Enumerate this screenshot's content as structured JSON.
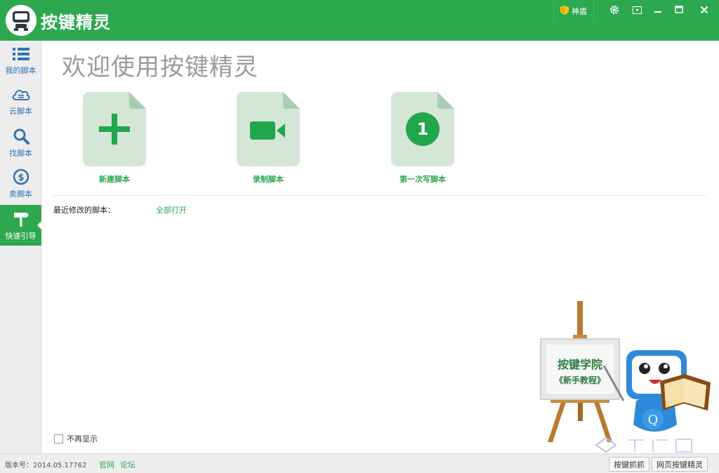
{
  "app": {
    "title": "按键精灵"
  },
  "titlebar": {
    "shield_label": "神盾"
  },
  "sidebar": {
    "items": [
      {
        "label": "我的脚本"
      },
      {
        "label": "云脚本"
      },
      {
        "label": "找脚本"
      },
      {
        "label": "卖脚本"
      },
      {
        "label": "快速引导"
      }
    ]
  },
  "main": {
    "welcome_title": "欢迎使用按键精灵",
    "cards": [
      {
        "label": "新建脚本",
        "icon": "plus-icon"
      },
      {
        "label": "录制脚本",
        "icon": "video-camera-icon"
      },
      {
        "label": "第一次写脚本",
        "icon": "number-one-icon",
        "badge": "1"
      }
    ],
    "recent_label": "最近修改的脚本：",
    "open_all_label": "全部打开",
    "dont_show_label": "不再显示",
    "academy": {
      "title": "按键学院",
      "subtitle": "《新手教程》"
    },
    "mascot_letter": "Q"
  },
  "statusbar": {
    "version_text": "版本号：2014.05.17762",
    "link_official": "官网",
    "link_forum": "论坛",
    "button_capture": "按键抓抓",
    "button_web": "网页按键精灵"
  },
  "colors": {
    "accent": "#2ea84f",
    "card_bg": "#d4e6d6",
    "link_blue": "#2f74b4"
  }
}
